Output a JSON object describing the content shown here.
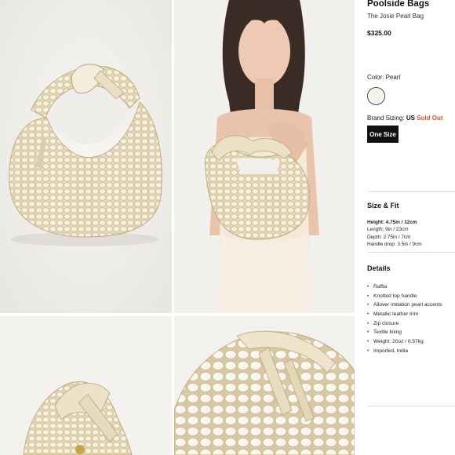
{
  "product": {
    "brand": "Poolside Bags",
    "name": "The Josie Pearl Bag",
    "price": "$325.00",
    "color_label": "Color: Pearl",
    "swatch_color": "#f4f2e6",
    "brand_sizing_label": "Brand Sizing:",
    "brand_sizing_value": "US",
    "sold_out_label": "Sold Out",
    "size_option": "One Size"
  },
  "size_fit": {
    "title": "Size & Fit",
    "height": "Height: 4.75in / 12cm",
    "length": "Length: 9in / 23cm",
    "depth": "Depth: 2.75in / 7cm",
    "handle_drop": "Handle drop: 3.5in / 9cm"
  },
  "details": {
    "title": "Details",
    "items": [
      "Raffia",
      "Knotted top handle",
      "Allover imitation pearl accents",
      "Metallic leather trim",
      "Zip closure",
      "Textile lining",
      "Weight: 20oz / 0.57kg",
      "Imported, India"
    ]
  },
  "colors": {
    "accent_sold_out": "#c8572a",
    "button_bg": "#111111",
    "pearl": "#f1ead6"
  }
}
